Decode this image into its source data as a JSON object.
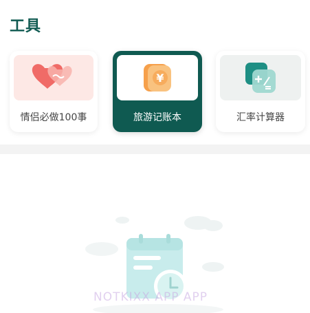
{
  "section": {
    "title": "工具"
  },
  "tools": [
    {
      "label": "情侣必做100事",
      "icon": "hearts-icon",
      "selected": false
    },
    {
      "label": "旅游记账本",
      "icon": "yen-wallet-icon",
      "selected": true
    },
    {
      "label": "汇率计算器",
      "icon": "calculator-icon",
      "selected": false
    }
  ],
  "watermark": {
    "text": "NOTKIXX APP APP"
  },
  "colors": {
    "brand": "#0f5a51",
    "love_bg": "#fde8e5",
    "heart": "#f06b67",
    "coin": "#f6a04b",
    "rate_bg": "#eef1f0",
    "teal": "#1e8f84"
  }
}
